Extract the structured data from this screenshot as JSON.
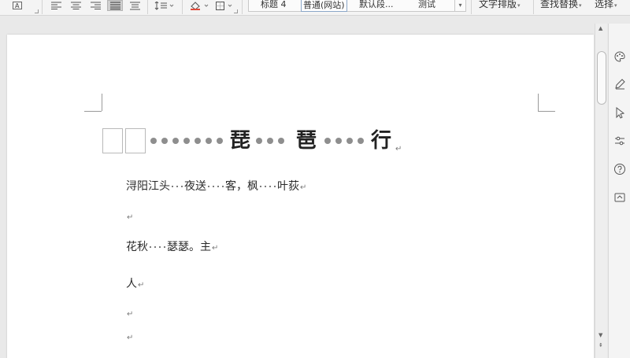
{
  "ribbon": {
    "style_gallery": [
      "标题 4",
      "普通(网站)",
      "默认段...",
      "测试"
    ],
    "selected_style": "普通(网站)",
    "text_layout_label": "文字排版",
    "find_replace_label": "查找替换",
    "select_label": "选择"
  },
  "document": {
    "title_chars": [
      "琵",
      "琶",
      "行"
    ],
    "lines": [
      {
        "segments": [
          "浔阳江头",
          "夜送",
          "客，枫",
          "叶荻"
        ],
        "dots": [
          3,
          4,
          4
        ]
      },
      {
        "segments": [
          "花秋",
          "瑟瑟。主"
        ],
        "dots": [
          4
        ]
      },
      {
        "segments": [
          "人"
        ],
        "dots": []
      }
    ]
  },
  "colors": {
    "page": "#ffffff",
    "workspace": "#e9e9e9",
    "ribbon": "#f4f4f4",
    "dots": "#8e8e8e"
  }
}
